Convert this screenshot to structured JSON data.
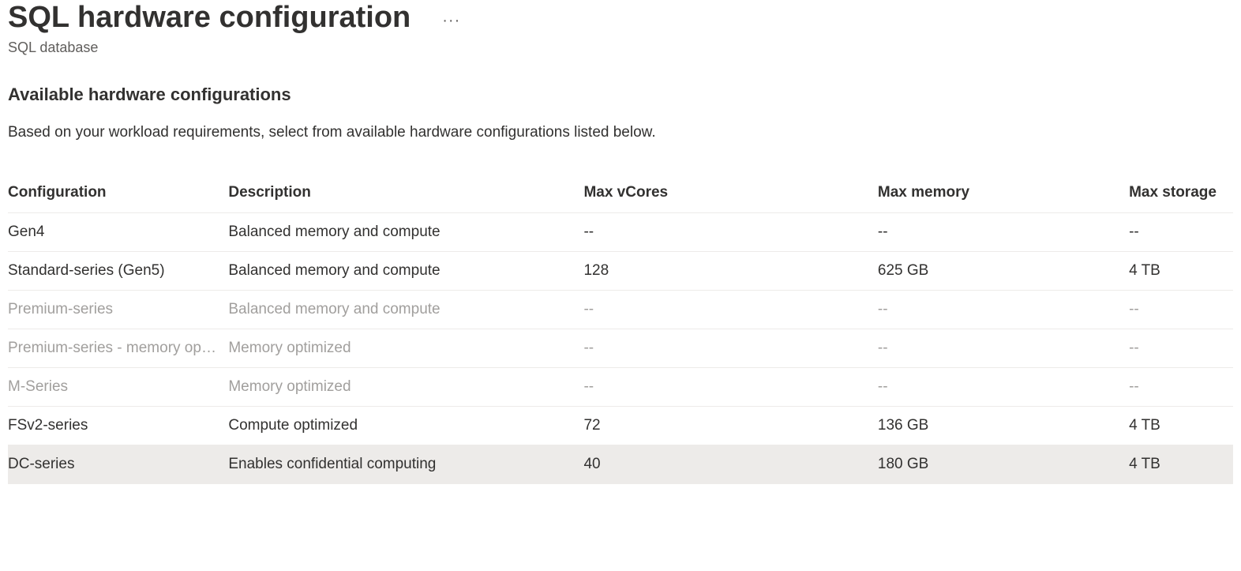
{
  "header": {
    "title": "SQL hardware configuration",
    "subtitle": "SQL database"
  },
  "section": {
    "heading": "Available hardware configurations",
    "description": "Based on your workload requirements, select from available hardware configurations listed below."
  },
  "table": {
    "columns": [
      "Configuration",
      "Description",
      "Max vCores",
      "Max memory",
      "Max storage"
    ],
    "rows": [
      {
        "config": "Gen4",
        "description": "Balanced memory and compute",
        "max_vcores": "--",
        "max_memory": "--",
        "max_storage": "--",
        "disabled": false,
        "selected": false
      },
      {
        "config": "Standard-series (Gen5)",
        "description": "Balanced memory and compute",
        "max_vcores": "128",
        "max_memory": "625 GB",
        "max_storage": "4 TB",
        "disabled": false,
        "selected": false
      },
      {
        "config": "Premium-series",
        "description": "Balanced memory and compute",
        "max_vcores": "--",
        "max_memory": "--",
        "max_storage": "--",
        "disabled": true,
        "selected": false
      },
      {
        "config": "Premium-series - memory optimized",
        "description": "Memory optimized",
        "max_vcores": "--",
        "max_memory": "--",
        "max_storage": "--",
        "disabled": true,
        "selected": false
      },
      {
        "config": "M-Series",
        "description": "Memory optimized",
        "max_vcores": "--",
        "max_memory": "--",
        "max_storage": "--",
        "disabled": true,
        "selected": false
      },
      {
        "config": "FSv2-series",
        "description": "Compute optimized",
        "max_vcores": "72",
        "max_memory": "136 GB",
        "max_storage": "4 TB",
        "disabled": false,
        "selected": false
      },
      {
        "config": "DC-series",
        "description": "Enables confidential computing",
        "max_vcores": "40",
        "max_memory": "180 GB",
        "max_storage": "4 TB",
        "disabled": false,
        "selected": true
      }
    ]
  }
}
